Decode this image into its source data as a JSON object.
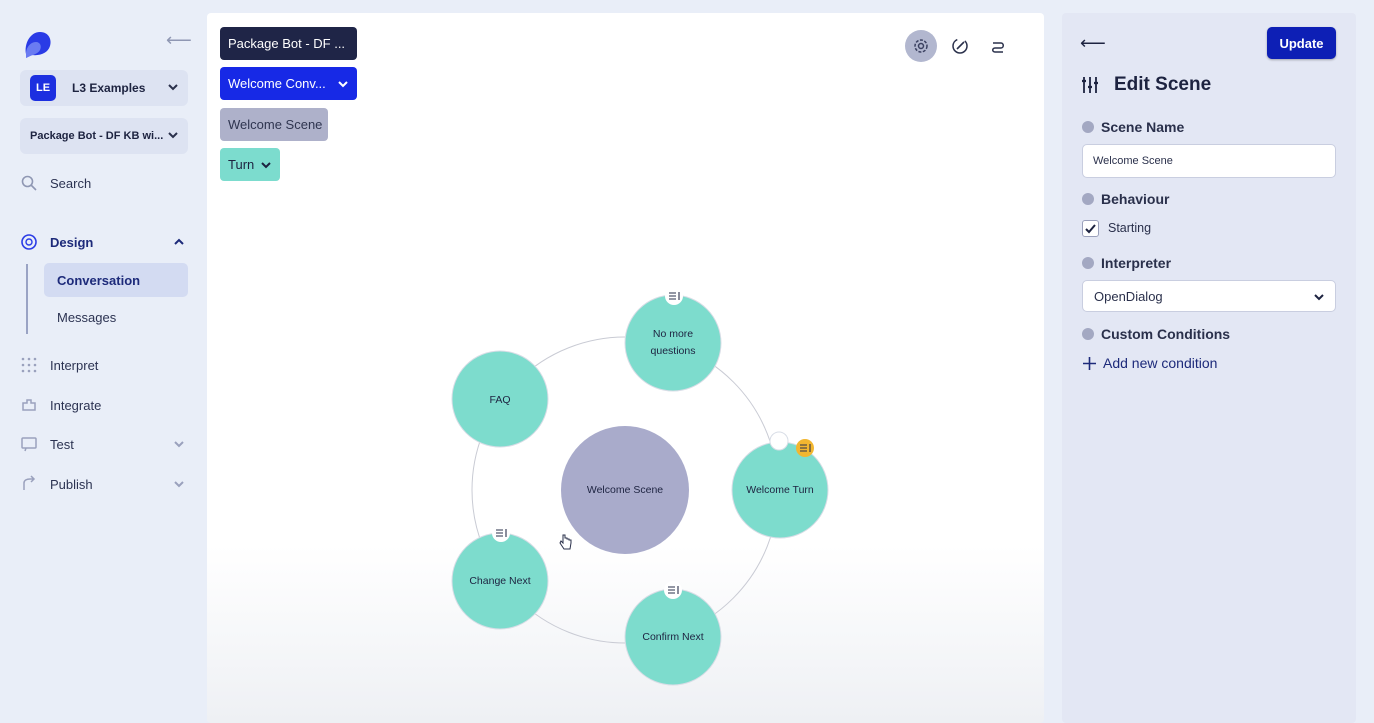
{
  "sidebar": {
    "workspace": {
      "badge": "LE",
      "label": "L3 Examples"
    },
    "bot_selector": {
      "label": "Package Bot - DF KB wi..."
    },
    "items": [
      {
        "label": "Search",
        "icon": "search-icon"
      },
      {
        "label": "Design",
        "icon": "design-icon"
      },
      {
        "label": "Interpret",
        "icon": "interpret-icon"
      },
      {
        "label": "Integrate",
        "icon": "integrate-icon"
      },
      {
        "label": "Test",
        "icon": "test-icon"
      },
      {
        "label": "Publish",
        "icon": "publish-icon"
      }
    ],
    "design_sub": [
      {
        "label": "Conversation",
        "active": true
      },
      {
        "label": "Messages",
        "active": false
      }
    ]
  },
  "canvas": {
    "breadcrumbs": {
      "bot": "Package Bot - DF ...",
      "conversation": "Welcome Conv...",
      "scene": "Welcome Scene",
      "turn": "Turn"
    },
    "tools": [
      "settings-icon",
      "edit-icon",
      "route-icon"
    ],
    "graph": {
      "center": "Welcome Scene",
      "nodes": [
        "No more questions",
        "Welcome Turn",
        "Confirm Next",
        "Change Next",
        "FAQ"
      ]
    },
    "colors": {
      "turn_node": "#7ddccd",
      "scene_node": "#a9abcb",
      "highlight_badge": "#f2b630"
    }
  },
  "panel": {
    "update_label": "Update",
    "title": "Edit Scene",
    "scene_name_label": "Scene Name",
    "scene_name_value": "Welcome Scene",
    "behaviour_label": "Behaviour",
    "starting_label": "Starting",
    "interpreter_label": "Interpreter",
    "interpreter_value": "OpenDialog",
    "custom_conditions_label": "Custom Conditions",
    "add_condition_label": "Add new condition"
  }
}
